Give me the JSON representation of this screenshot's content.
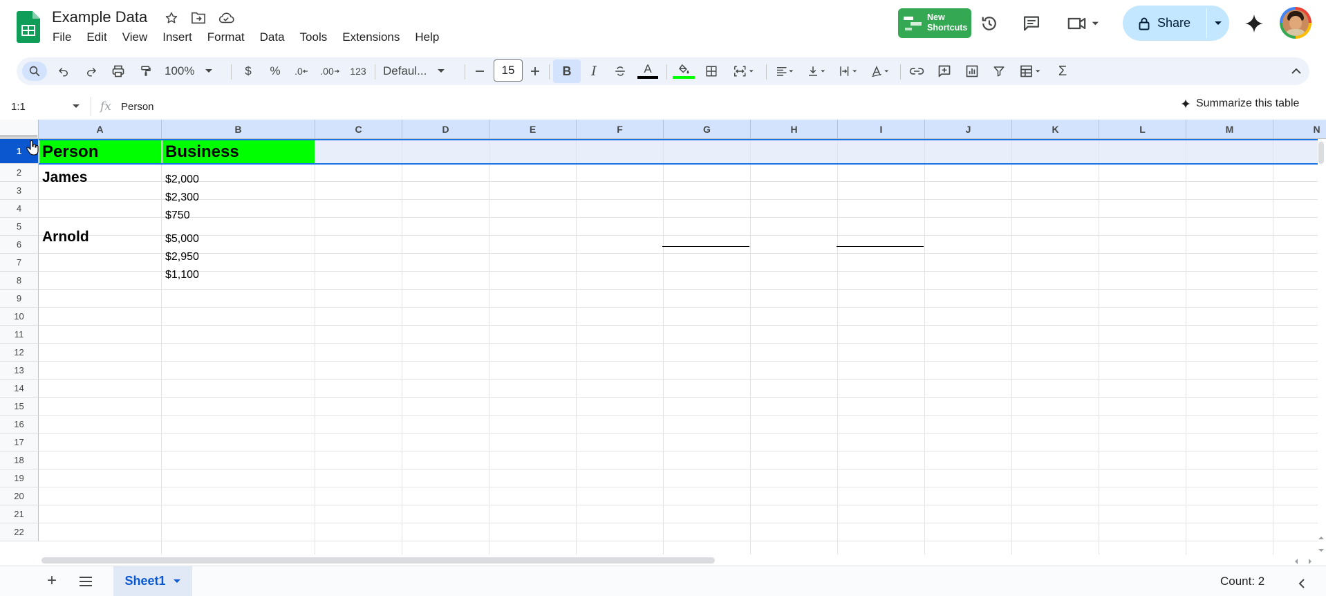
{
  "doc": {
    "title": "Example Data"
  },
  "menu": [
    "File",
    "Edit",
    "View",
    "Insert",
    "Format",
    "Data",
    "Tools",
    "Extensions",
    "Help"
  ],
  "header_right": {
    "shortcuts_line1": "New",
    "shortcuts_line2": "Shortcuts",
    "share_label": "Share"
  },
  "toolbar": {
    "zoom": "100%",
    "currency": "$",
    "percent": "%",
    "dec_decrease": ".0",
    "dec_increase": ".00",
    "number_format": "123",
    "font": "Defaul...",
    "font_size": "15",
    "bold": "B",
    "italic": "I",
    "text_color_letter": "A",
    "text_color": "#000000",
    "fill_color": "#00ff00",
    "sum": "Σ"
  },
  "formula_bar": {
    "name_box": "1:1",
    "fx": "fx",
    "value": "Person",
    "summarize": "Summarize this table"
  },
  "grid": {
    "columns": [
      "A",
      "B",
      "C",
      "D",
      "E",
      "F",
      "G",
      "H",
      "I",
      "J",
      "K",
      "L",
      "M",
      "N"
    ],
    "rows": [
      "1",
      "2",
      "3",
      "4",
      "5",
      "6",
      "7",
      "8",
      "9",
      "10",
      "11",
      "12",
      "13",
      "14",
      "15",
      "16",
      "17",
      "18",
      "19",
      "20",
      "21",
      "22"
    ],
    "header_row": {
      "a1": "Person",
      "b1": "Business",
      "fill": "#00ff00"
    },
    "cells": {
      "a2": "James",
      "b2": "$2,000",
      "b3": "$2,300",
      "b4": "$750",
      "a5": "Arnold",
      "b5": "$5,000",
      "b6": "$2,950",
      "b7": "$1,100"
    }
  },
  "bottom": {
    "add_sheet": "+",
    "sheet_name": "Sheet1",
    "status": "Count: 2"
  },
  "icons": {
    "logo": "sheets-logo-icon",
    "star": "star-icon",
    "move": "folder-move-icon",
    "cloud": "cloud-status-icon",
    "history": "history-icon",
    "comment": "comment-icon",
    "meet": "video-call-icon",
    "lock": "lock-icon",
    "gemini": "gemini-sparkle-icon"
  },
  "colors": {
    "accent": "#0b57d0",
    "selection": "#1a73e8",
    "share_bg": "#c2e7ff",
    "toolbar_bg": "#eef3fb",
    "brand_green": "#34a853"
  }
}
